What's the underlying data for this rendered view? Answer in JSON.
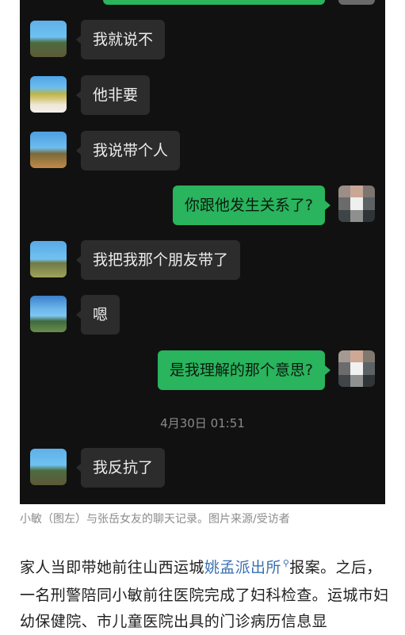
{
  "chat": {
    "messages": [
      {
        "side": "left",
        "text": "我就说不"
      },
      {
        "side": "left",
        "text": "他非要"
      },
      {
        "side": "left",
        "text": "我说带个人"
      },
      {
        "side": "right",
        "text": "你跟他发生关系了?"
      },
      {
        "side": "left",
        "text": "我把我那个朋友带了"
      },
      {
        "side": "left",
        "text": "嗯"
      },
      {
        "side": "right",
        "text": "是我理解的那个意思?"
      },
      {
        "side": "left",
        "text": "我反抗了"
      }
    ],
    "timestamp": "4月30日 01:51"
  },
  "caption": "小敏（图左）与张岳女友的聊天记录。图片来源/受访者",
  "article": {
    "p1_before": "家人当即带她前往山西运城",
    "p1_link": "姚孟派出所",
    "p1_link_icon": "search-icon",
    "p1_after": "报案。之后，一名刑警陪同小敏前往医院完成了妇科检查。运城市妇幼保健院、市儿童医院出具的门诊病历信息显"
  },
  "colors": {
    "chat_background": "#111111",
    "incoming_bubble": "#2c2c2c",
    "outgoing_bubble": "#29b45d",
    "link": "#3a6fb0"
  }
}
